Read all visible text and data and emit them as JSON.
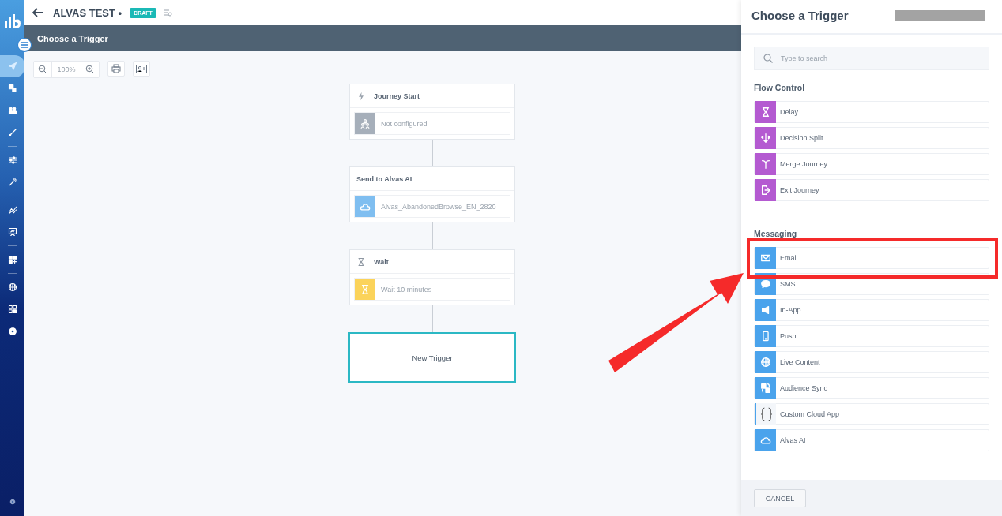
{
  "sidebar": {
    "groups": [
      {
        "items": [
          {
            "kind": "send",
            "selected": true
          },
          {
            "kind": "content",
            "selected": false
          },
          {
            "kind": "audience",
            "selected": false
          },
          {
            "kind": "brush",
            "selected": false
          }
        ]
      },
      {
        "items": [
          {
            "kind": "sliders",
            "selected": false
          },
          {
            "kind": "wand",
            "selected": false
          }
        ]
      },
      {
        "items": [
          {
            "kind": "chart",
            "selected": false
          },
          {
            "kind": "board",
            "selected": false
          }
        ]
      },
      {
        "items": [
          {
            "kind": "apps",
            "selected": false
          }
        ]
      },
      {
        "items": [
          {
            "kind": "globe",
            "selected": false
          },
          {
            "kind": "qr",
            "selected": false
          },
          {
            "kind": "gear",
            "selected": false
          }
        ]
      }
    ]
  },
  "header": {
    "title": "ALVAS TEST •",
    "status": "DRAFT"
  },
  "subheader": {
    "title": "Choose a Trigger"
  },
  "toolbar": {
    "zoom": "100%"
  },
  "journey": {
    "nodes": [
      {
        "kind": "start",
        "title": "Journey Start",
        "detail": "Not configured"
      },
      {
        "kind": "action",
        "title": "Send to Alvas AI",
        "detail": "Alvas_AbandonedBrowse_EN_2820"
      },
      {
        "kind": "wait",
        "title": "Wait",
        "detail": "Wait 10 minutes"
      },
      {
        "kind": "new",
        "title": "New Trigger"
      }
    ]
  },
  "panel": {
    "title": "Choose a Trigger",
    "search": {
      "placeholder": "Type to search"
    },
    "sections": [
      {
        "kind": "flow",
        "title": "Flow Control",
        "items": [
          {
            "kind": "delay",
            "label": "Delay"
          },
          {
            "kind": "split",
            "label": "Decision Split"
          },
          {
            "kind": "merge",
            "label": "Merge Journey"
          },
          {
            "kind": "exit",
            "label": "Exit Journey"
          }
        ]
      },
      {
        "kind": "messaging",
        "title": "Messaging",
        "items": [
          {
            "kind": "email",
            "label": "Email"
          },
          {
            "kind": "sms",
            "label": "SMS"
          },
          {
            "kind": "inapp",
            "label": "In-App"
          },
          {
            "kind": "push",
            "label": "Push"
          },
          {
            "kind": "live",
            "label": "Live Content"
          },
          {
            "kind": "sync",
            "label": "Audience Sync"
          },
          {
            "kind": "custom",
            "label": "Custom Cloud App"
          },
          {
            "kind": "cloud",
            "label": "Alvas AI"
          }
        ]
      }
    ],
    "cancel": "CANCEL"
  }
}
